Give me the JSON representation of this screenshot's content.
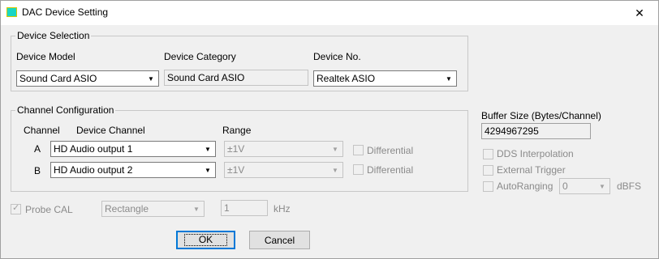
{
  "window": {
    "title": "DAC Device Setting",
    "close_glyph": "✕"
  },
  "device_selection": {
    "legend": "Device Selection",
    "model_label": "Device Model",
    "model_value": "Sound Card ASIO",
    "category_label": "Device Category",
    "category_value": "Sound Card ASIO",
    "number_label": "Device No.",
    "number_value": "Realtek ASIO"
  },
  "channel_config": {
    "legend": "Channel Configuration",
    "headers": {
      "channel": "Channel",
      "device_channel": "Device Channel",
      "range": "Range"
    },
    "rows": [
      {
        "channel": "A",
        "device_channel": "HD Audio output 1",
        "range": "±1V",
        "differential_label": "Differential",
        "differential_checked": false
      },
      {
        "channel": "B",
        "device_channel": "HD Audio output 2",
        "range": "±1V",
        "differential_label": "Differential",
        "differential_checked": false
      }
    ]
  },
  "buffer": {
    "label": "Buffer Size (Bytes/Channel)",
    "value": "4294967295"
  },
  "options": {
    "dds_label": "DDS Interpolation",
    "dds_checked": false,
    "external_trigger_label": "External Trigger",
    "external_trigger_checked": false,
    "autoranging_label": "AutoRanging",
    "autoranging_checked": false,
    "autoranging_value": "0",
    "autoranging_unit": "dBFS"
  },
  "probe_cal": {
    "label": "Probe CAL",
    "checked": true,
    "waveform": "Rectangle",
    "frequency": "1",
    "frequency_unit": "kHz"
  },
  "buttons": {
    "ok": "OK",
    "cancel": "Cancel"
  },
  "icons": {
    "app": "app-icon",
    "dropdown": "chevron-down-icon",
    "close": "close-icon"
  },
  "colors": {
    "app_icon_fill": "#19d6c4",
    "default_button_border": "#0078d7"
  }
}
